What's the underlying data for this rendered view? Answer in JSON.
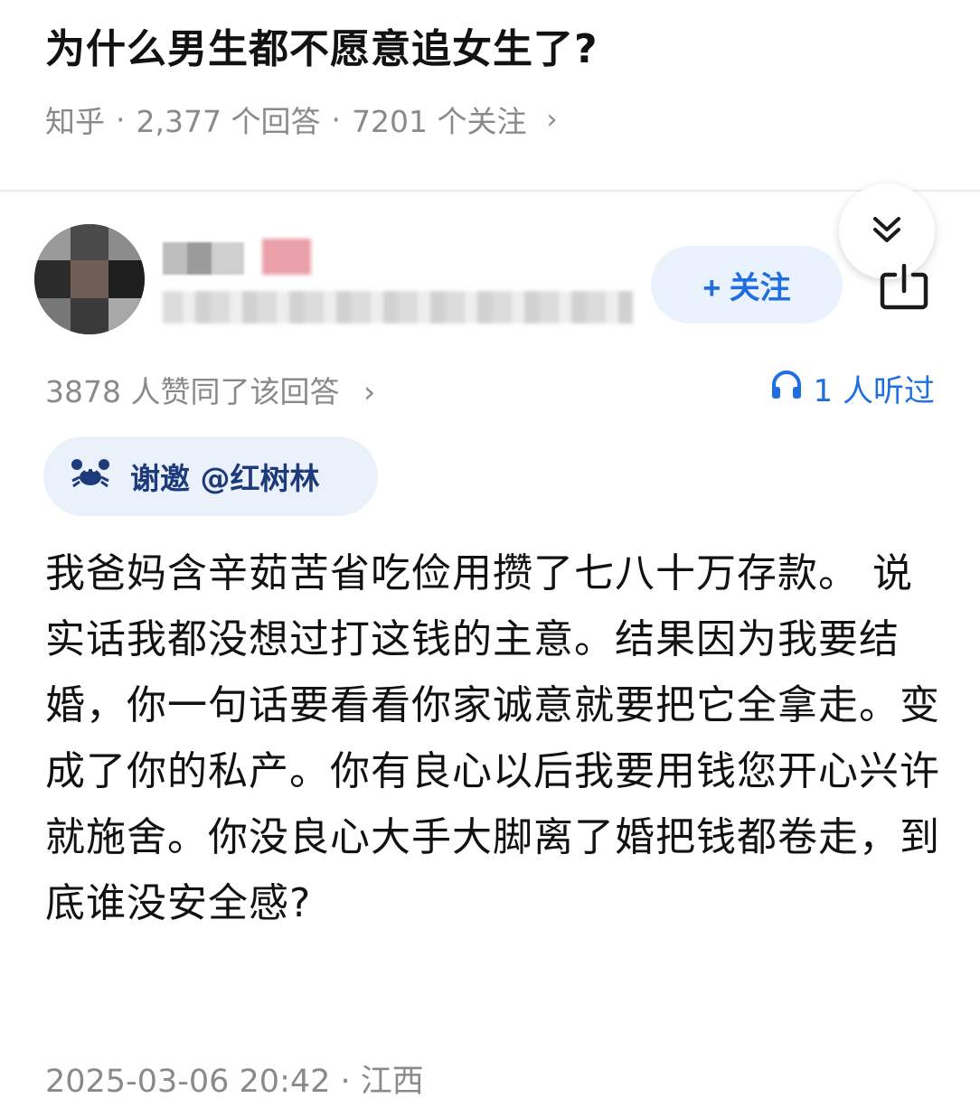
{
  "question": {
    "title": "为什么男生都不愿意追女生了?",
    "source": "知乎",
    "answer_count": "2,377 个回答",
    "follower_count": "7201 个关注",
    "separator": "·",
    "chevron": "›"
  },
  "author": {
    "follow_label": "+ 关注",
    "collapse_icon": "double-chevron-down-icon",
    "share_icon": "share-icon"
  },
  "stats": {
    "likes": "3878 人赞同了该回答",
    "listened": "1 人听过",
    "accent_color": "#1f6fe0"
  },
  "invite": {
    "label": "谢邀 @红树林"
  },
  "answer": {
    "content": "我爸妈含辛茹苦省吃俭用攒了七八十万存款。 说实话我都没想过打这钱的主意。结果因为我要结婚，你一句话要看看你家诚意就要把它全拿走。变成了你的私产。你有良心以后我要用钱您开心兴许就施舍。你没良心大手大脚离了婚把钱都卷走，到底谁没安全感?",
    "footer": "2025-03-06 20:42 · 江西"
  }
}
